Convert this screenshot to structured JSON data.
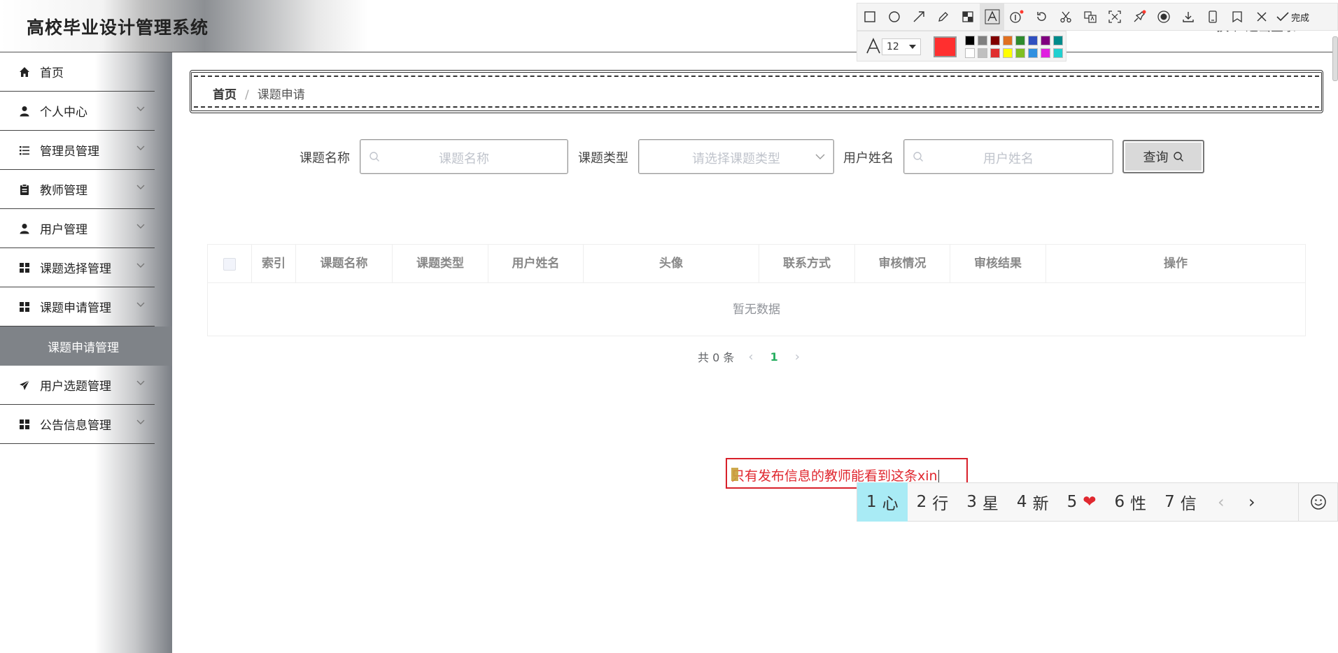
{
  "header": {
    "app_title": "高校毕业设计管理系统",
    "right_text": "换个    退出登录"
  },
  "sidebar": {
    "items": [
      {
        "label": "首页",
        "icon": "home-icon"
      },
      {
        "label": "个人中心",
        "icon": "user-icon"
      },
      {
        "label": "管理员管理",
        "icon": "list-icon"
      },
      {
        "label": "教师管理",
        "icon": "clipboard-icon"
      },
      {
        "label": "用户管理",
        "icon": "user-icon"
      },
      {
        "label": "课题选择管理",
        "icon": "grid-icon"
      },
      {
        "label": "课题申请管理",
        "icon": "grid-icon"
      },
      {
        "label": "用户选题管理",
        "icon": "send-icon"
      },
      {
        "label": "公告信息管理",
        "icon": "grid-icon"
      }
    ],
    "active_sub": "课题申请管理"
  },
  "breadcrumb": {
    "home": "首页",
    "separator": "/",
    "current": "课题申请"
  },
  "search": {
    "title_label": "课题名称",
    "title_placeholder": "课题名称",
    "type_label": "课题类型",
    "type_placeholder": "请选择课题类型",
    "user_label": "用户姓名",
    "user_placeholder": "用户姓名",
    "query_button": "查询"
  },
  "table": {
    "columns": [
      "索引",
      "课题名称",
      "课题类型",
      "用户姓名",
      "头像",
      "联系方式",
      "审核情况",
      "审核结果",
      "操作"
    ],
    "empty_text": "暂无数据"
  },
  "pagination": {
    "total": "共 0 条",
    "current_page": "1"
  },
  "annotation": {
    "text": "只有发布信息的教师能看到这条xin"
  },
  "screenshot_tool": {
    "done_label": "完成",
    "font_size": "12",
    "current_color": "#ff2f2f",
    "swatches_top": [
      "#000000",
      "#808080",
      "#800000",
      "#e07020",
      "#2e8b2e",
      "#3050c0",
      "#800080",
      "#008b8b"
    ],
    "swatches_bottom": [
      "#ffffff",
      "#c0c0c0",
      "#e03030",
      "#ffff00",
      "#7fbf20",
      "#3090e0",
      "#e020e0",
      "#20d0d0"
    ]
  },
  "ime": {
    "candidates": [
      {
        "n": "1",
        "text": "心"
      },
      {
        "n": "2",
        "text": "行"
      },
      {
        "n": "3",
        "text": "星"
      },
      {
        "n": "4",
        "text": "新"
      },
      {
        "n": "5",
        "text": "❤"
      },
      {
        "n": "6",
        "text": "性"
      },
      {
        "n": "7",
        "text": "信"
      }
    ]
  }
}
